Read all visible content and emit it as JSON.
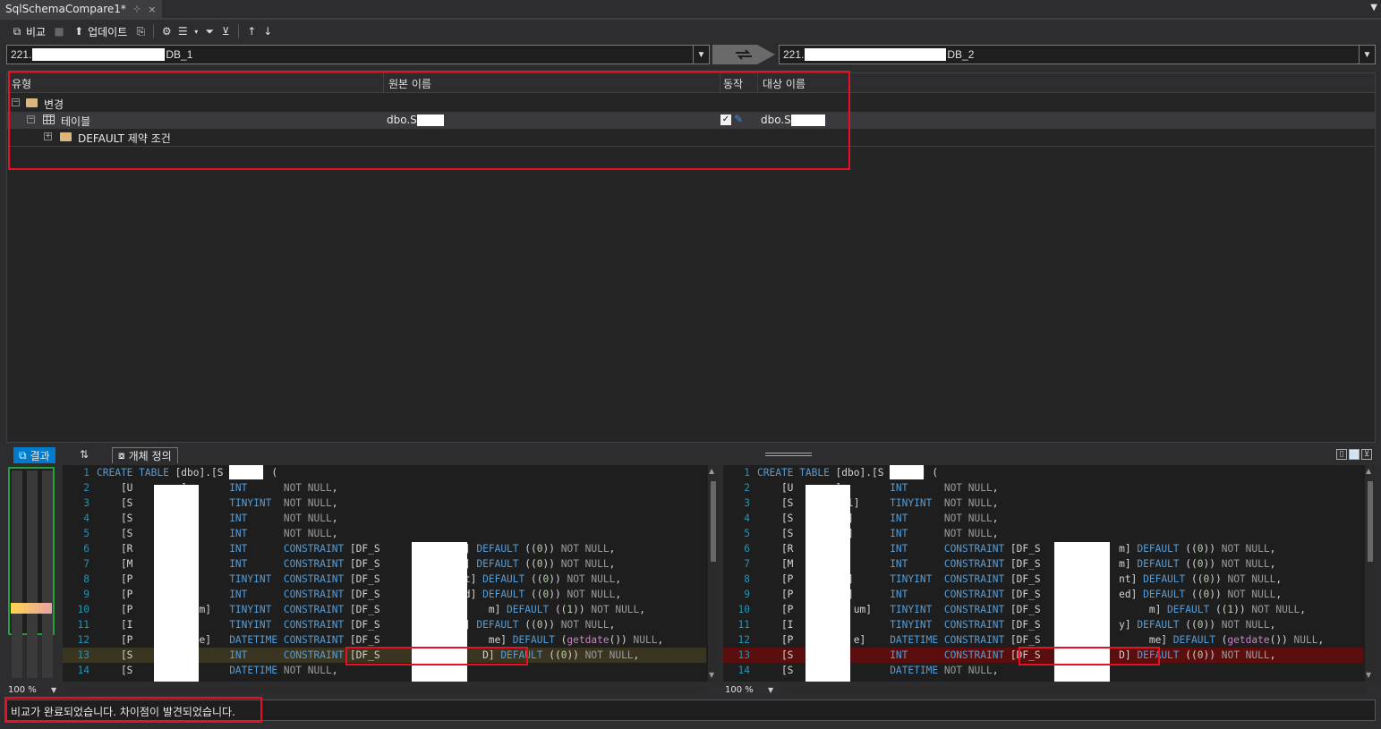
{
  "window": {
    "tab_title": "SqlSchemaCompare1*",
    "pin_glyph": "⊹",
    "close_glyph": "×",
    "dropdown_glyph": "▼"
  },
  "toolbar": {
    "compare_label": "비교",
    "update_label": "업데이트"
  },
  "source_db": {
    "prefix": "221.",
    "suffix": "DB_1"
  },
  "target_db": {
    "prefix": "221.",
    "suffix": "DB_2"
  },
  "grid": {
    "columns": {
      "type": "유형",
      "source_name": "원본 이름",
      "action": "동작",
      "target_name": "대상 이름"
    },
    "rows": [
      {
        "label": "변경",
        "expander": "−"
      },
      {
        "label": "테이블",
        "expander": "−",
        "source_name": "dbo.S",
        "target_name": "dbo.S",
        "checked": "✓"
      },
      {
        "label": "DEFAULT 제약 조건",
        "expander": "+"
      }
    ]
  },
  "lower_tabs": {
    "results_label": "결과",
    "objdef_label": "개체 정의",
    "sort_glyph": "⇅"
  },
  "left_code": [
    {
      "n": "1",
      "t": "CREATE TABLE [dbo].[S      ] ("
    },
    {
      "n": "2",
      "t": "    [U      ey]       INT      NOT NULL,"
    },
    {
      "n": "3",
      "t": "    [S        l]      TINYINT  NOT NULL,"
    },
    {
      "n": "4",
      "t": "    [S        e]      INT      NOT NULL,"
    },
    {
      "n": "5",
      "t": "    [S        D]      INT      NOT NULL,"
    },
    {
      "n": "6",
      "t": "    [R       m]       INT      CONSTRAINT [DF_S      R      m] DEFAULT ((0)) NOT NULL,"
    },
    {
      "n": "7",
      "t": "    [M       m]       INT      CONSTRAINT [DF_S      M      m] DEFAULT ((0)) NOT NULL,"
    },
    {
      "n": "8",
      "t": "    [P       nt]      TINYINT  CONSTRAINT [DF_S      P      nt] DEFAULT ((0)) NOT NULL,"
    },
    {
      "n": "9",
      "t": "    [P       ed]      INT      CONSTRAINT [DF_S      P      ed] DEFAULT ((0)) NOT NULL,"
    },
    {
      "n": "10",
      "t": "    [P          um]   TINYINT  CONSTRAINT [DF_S      P           m] DEFAULT ((1)) NOT NULL,"
    },
    {
      "n": "11",
      "t": "    [I      y]        TINYINT  CONSTRAINT [DF_S      I      y] DEFAULT ((0)) NOT NULL,"
    },
    {
      "n": "12",
      "t": "    [P          me]   DATETIME CONSTRAINT [DF_S      P           me] DEFAULT (getdate()) NULL,"
    },
    {
      "n": "13",
      "t": "    [S       D]       INT      CONSTRAINT [DF_S      A          D] DEFAULT ((0)) NOT NULL,"
    },
    {
      "n": "14",
      "t": "    [S       e]       DATETIME NOT NULL,"
    }
  ],
  "right_code": [
    {
      "n": "1",
      "t": "CREATE TABLE [dbo].[S      ] ("
    },
    {
      "n": "2",
      "t": "    [U      y]        INT      NOT NULL,"
    },
    {
      "n": "3",
      "t": "    [S        el]     TINYINT  NOT NULL,"
    },
    {
      "n": "4",
      "t": "    [S        e]      INT      NOT NULL,"
    },
    {
      "n": "5",
      "t": "    [S        D]      INT      NOT NULL,"
    },
    {
      "n": "6",
      "t": "    [R       m]       INT      CONSTRAINT [DF_S      R      m] DEFAULT ((0)) NOT NULL,"
    },
    {
      "n": "7",
      "t": "    [M       m]       INT      CONSTRAINT [DF_S      M      m] DEFAULT ((0)) NOT NULL,"
    },
    {
      "n": "8",
      "t": "    [P       nt]      TINYINT  CONSTRAINT [DF_S      P      nt] DEFAULT ((0)) NOT NULL,"
    },
    {
      "n": "9",
      "t": "    [P       ed]      INT      CONSTRAINT [DF_S      P      ed] DEFAULT ((0)) NOT NULL,"
    },
    {
      "n": "10",
      "t": "    [P          um]   TINYINT  CONSTRAINT [DF_S      P           m] DEFAULT ((1)) NOT NULL,"
    },
    {
      "n": "11",
      "t": "    [I      y]        TINYINT  CONSTRAINT [DF_S      I      y] DEFAULT ((0)) NOT NULL,"
    },
    {
      "n": "12",
      "t": "    [P          e]    DATETIME CONSTRAINT [DF_S      P           me] DEFAULT (getdate()) NULL,"
    },
    {
      "n": "13",
      "t": "    [S       D]       INT      CONSTRAINT [DF_S      S      D] DEFAULT ((0)) NOT NULL,"
    },
    {
      "n": "14",
      "t": "    [S       e]       DATETIME NOT NULL,"
    }
  ],
  "zoom": {
    "left": "100 %",
    "right": "100 %"
  },
  "status": {
    "text": "비교가 완료되었습니다. 차이점이 발견되었습니다."
  },
  "colors": {
    "accent": "#007acc",
    "highlight_box": "#e81123",
    "overview_border": "#1ea33b"
  }
}
